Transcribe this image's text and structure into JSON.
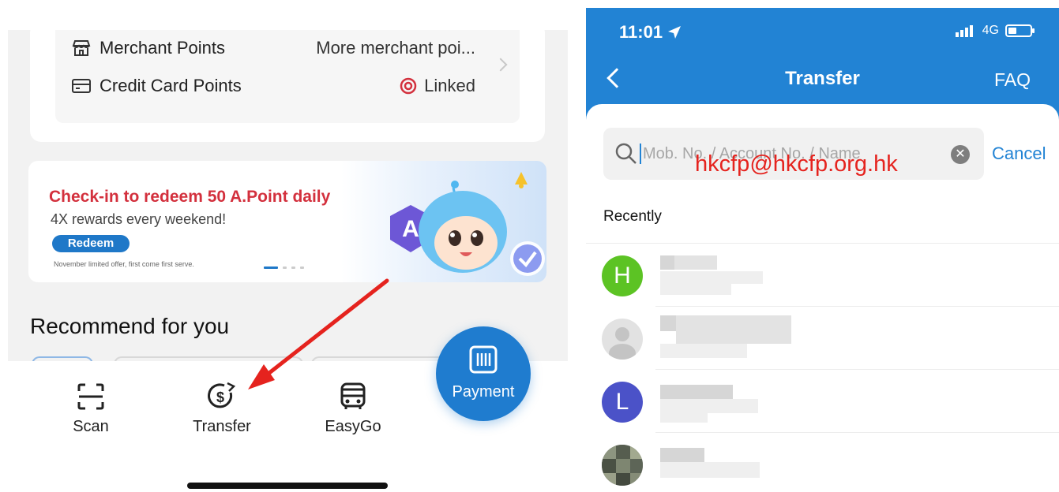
{
  "left": {
    "points": {
      "merchant_label": "Merchant Points",
      "merchant_value": "More merchant poi...",
      "credit_label": "Credit Card Points",
      "credit_value": "Linked"
    },
    "banner": {
      "title": "Check-in to redeem 50 A.Point daily",
      "subtitle": "4X rewards every weekend!",
      "button": "Redeem",
      "note": "November limited offer, first come first serve."
    },
    "recommend_title": "Recommend for you",
    "nav": {
      "scan": "Scan",
      "transfer": "Transfer",
      "easygo": "EasyGo",
      "payment": "Payment"
    },
    "accent_color": "#1f7ccf",
    "arrow_color": "#e5231e"
  },
  "right": {
    "status": {
      "time": "11:01",
      "network": "4G"
    },
    "header": {
      "title": "Transfer",
      "faq": "FAQ"
    },
    "search": {
      "placeholder": "Mob. No. / Account No. / Name",
      "cancel": "Cancel"
    },
    "watermark": "hkcfp@hkcfp.org.hk",
    "recently_label": "Recently",
    "contacts": [
      {
        "initial": "H",
        "color": "#5cc324"
      },
      {
        "initial": "",
        "color": "#e2e2e2"
      },
      {
        "initial": "L",
        "color": "#4b52c8"
      },
      {
        "initial": "",
        "color": "#6f7868"
      }
    ],
    "header_color": "#2283d4"
  }
}
